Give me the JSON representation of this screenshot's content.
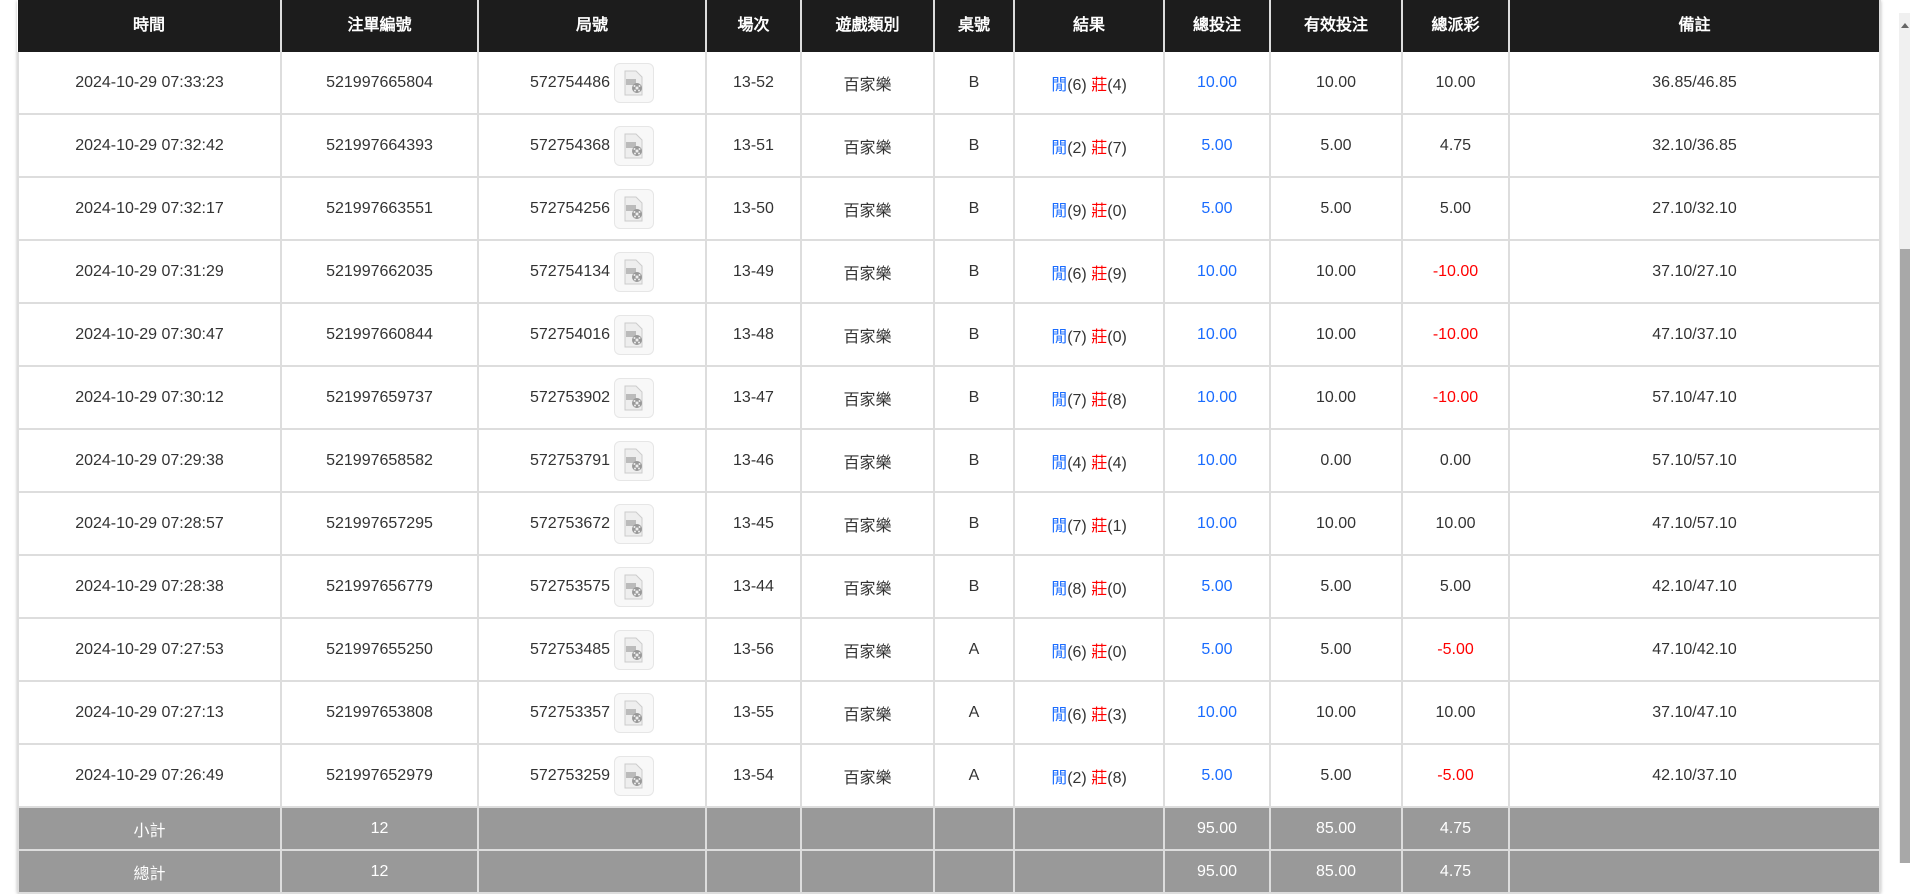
{
  "columns": [
    "時間",
    "注單編號",
    "局號",
    "場次",
    "遊戲類別",
    "桌號",
    "結果",
    "總投注",
    "有效投注",
    "總派彩",
    "備註"
  ],
  "result_labels": {
    "player": "閒",
    "banker": "莊"
  },
  "colors": {
    "header_bg": "#1c1c1c",
    "footer_bg": "#999999",
    "blue": "#1a6cff",
    "red": "#ff0000"
  },
  "rows": [
    {
      "time": "2024-10-29 07:33:23",
      "bet_id": "521997665804",
      "round": "572754486",
      "shoe": "13-52",
      "game": "百家樂",
      "table": "B",
      "player": "(6)",
      "banker": "(4)",
      "total_bet": "10.00",
      "valid_bet": "10.00",
      "payout": "10.00",
      "payout_neg": false,
      "note": "36.85/46.85"
    },
    {
      "time": "2024-10-29 07:32:42",
      "bet_id": "521997664393",
      "round": "572754368",
      "shoe": "13-51",
      "game": "百家樂",
      "table": "B",
      "player": "(2)",
      "banker": "(7)",
      "total_bet": "5.00",
      "valid_bet": "5.00",
      "payout": "4.75",
      "payout_neg": false,
      "note": "32.10/36.85"
    },
    {
      "time": "2024-10-29 07:32:17",
      "bet_id": "521997663551",
      "round": "572754256",
      "shoe": "13-50",
      "game": "百家樂",
      "table": "B",
      "player": "(9)",
      "banker": "(0)",
      "total_bet": "5.00",
      "valid_bet": "5.00",
      "payout": "5.00",
      "payout_neg": false,
      "note": "27.10/32.10"
    },
    {
      "time": "2024-10-29 07:31:29",
      "bet_id": "521997662035",
      "round": "572754134",
      "shoe": "13-49",
      "game": "百家樂",
      "table": "B",
      "player": "(6)",
      "banker": "(9)",
      "total_bet": "10.00",
      "valid_bet": "10.00",
      "payout": "-10.00",
      "payout_neg": true,
      "note": "37.10/27.10"
    },
    {
      "time": "2024-10-29 07:30:47",
      "bet_id": "521997660844",
      "round": "572754016",
      "shoe": "13-48",
      "game": "百家樂",
      "table": "B",
      "player": "(7)",
      "banker": "(0)",
      "total_bet": "10.00",
      "valid_bet": "10.00",
      "payout": "-10.00",
      "payout_neg": true,
      "note": "47.10/37.10"
    },
    {
      "time": "2024-10-29 07:30:12",
      "bet_id": "521997659737",
      "round": "572753902",
      "shoe": "13-47",
      "game": "百家樂",
      "table": "B",
      "player": "(7)",
      "banker": "(8)",
      "total_bet": "10.00",
      "valid_bet": "10.00",
      "payout": "-10.00",
      "payout_neg": true,
      "note": "57.10/47.10"
    },
    {
      "time": "2024-10-29 07:29:38",
      "bet_id": "521997658582",
      "round": "572753791",
      "shoe": "13-46",
      "game": "百家樂",
      "table": "B",
      "player": "(4)",
      "banker": "(4)",
      "total_bet": "10.00",
      "valid_bet": "0.00",
      "payout": "0.00",
      "payout_neg": false,
      "note": "57.10/57.10"
    },
    {
      "time": "2024-10-29 07:28:57",
      "bet_id": "521997657295",
      "round": "572753672",
      "shoe": "13-45",
      "game": "百家樂",
      "table": "B",
      "player": "(7)",
      "banker": "(1)",
      "total_bet": "10.00",
      "valid_bet": "10.00",
      "payout": "10.00",
      "payout_neg": false,
      "note": "47.10/57.10"
    },
    {
      "time": "2024-10-29 07:28:38",
      "bet_id": "521997656779",
      "round": "572753575",
      "shoe": "13-44",
      "game": "百家樂",
      "table": "B",
      "player": "(8)",
      "banker": "(0)",
      "total_bet": "5.00",
      "valid_bet": "5.00",
      "payout": "5.00",
      "payout_neg": false,
      "note": "42.10/47.10"
    },
    {
      "time": "2024-10-29 07:27:53",
      "bet_id": "521997655250",
      "round": "572753485",
      "shoe": "13-56",
      "game": "百家樂",
      "table": "A",
      "player": "(6)",
      "banker": "(0)",
      "total_bet": "5.00",
      "valid_bet": "5.00",
      "payout": "-5.00",
      "payout_neg": true,
      "note": "47.10/42.10"
    },
    {
      "time": "2024-10-29 07:27:13",
      "bet_id": "521997653808",
      "round": "572753357",
      "shoe": "13-55",
      "game": "百家樂",
      "table": "A",
      "player": "(6)",
      "banker": "(3)",
      "total_bet": "10.00",
      "valid_bet": "10.00",
      "payout": "10.00",
      "payout_neg": false,
      "note": "37.10/47.10"
    },
    {
      "time": "2024-10-29 07:26:49",
      "bet_id": "521997652979",
      "round": "572753259",
      "shoe": "13-54",
      "game": "百家樂",
      "table": "A",
      "player": "(2)",
      "banker": "(8)",
      "total_bet": "5.00",
      "valid_bet": "5.00",
      "payout": "-5.00",
      "payout_neg": true,
      "note": "42.10/37.10"
    }
  ],
  "footer": [
    {
      "label": "小計",
      "count": "12",
      "total_bet": "95.00",
      "valid_bet": "85.00",
      "payout": "4.75"
    },
    {
      "label": "總計",
      "count": "12",
      "total_bet": "95.00",
      "valid_bet": "85.00",
      "payout": "4.75"
    }
  ]
}
